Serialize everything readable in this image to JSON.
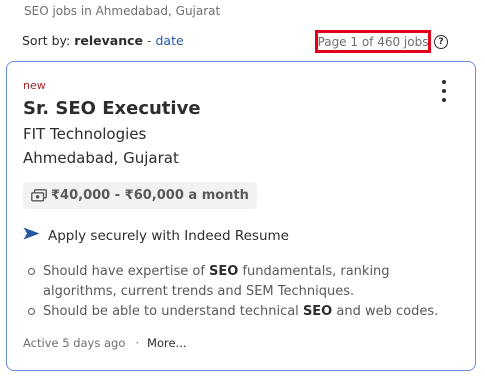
{
  "header": {
    "caption": "SEO jobs in Ahmedabad, Gujarat",
    "sort_label": "Sort by:",
    "sort_selected": "relevance",
    "sort_separator": "-",
    "sort_alternative": "date",
    "page_count": "Page 1 of 460 jobs",
    "help_icon_glyph": "?"
  },
  "job": {
    "badge": "new",
    "title": "Sr. SEO Executive",
    "company": "FIT Technologies",
    "location": "Ahmedabad, Gujarat",
    "salary": "₹40,000 - ₹60,000 a month",
    "apply_text": "Apply securely with Indeed Resume",
    "snippets": [
      {
        "before": "Should have expertise of ",
        "keyword": "SEO",
        "after": " fundamentals, ranking algorithms, current trends and SEM Techniques."
      },
      {
        "before": "Should be able to understand technical ",
        "keyword": "SEO",
        "after": " and web codes."
      }
    ],
    "posted": "Active 5 days ago",
    "footer_separator": "·",
    "more_link": "More..."
  },
  "colors": {
    "highlight_box": "#e3001b",
    "card_border": "#6b8fd6",
    "link": "#2557a7",
    "badge": "#a9252b"
  },
  "icons": {
    "help": "help-circle-icon",
    "menu": "kebab-menu-icon",
    "salary": "money-icon",
    "apply": "send-arrow-icon"
  }
}
